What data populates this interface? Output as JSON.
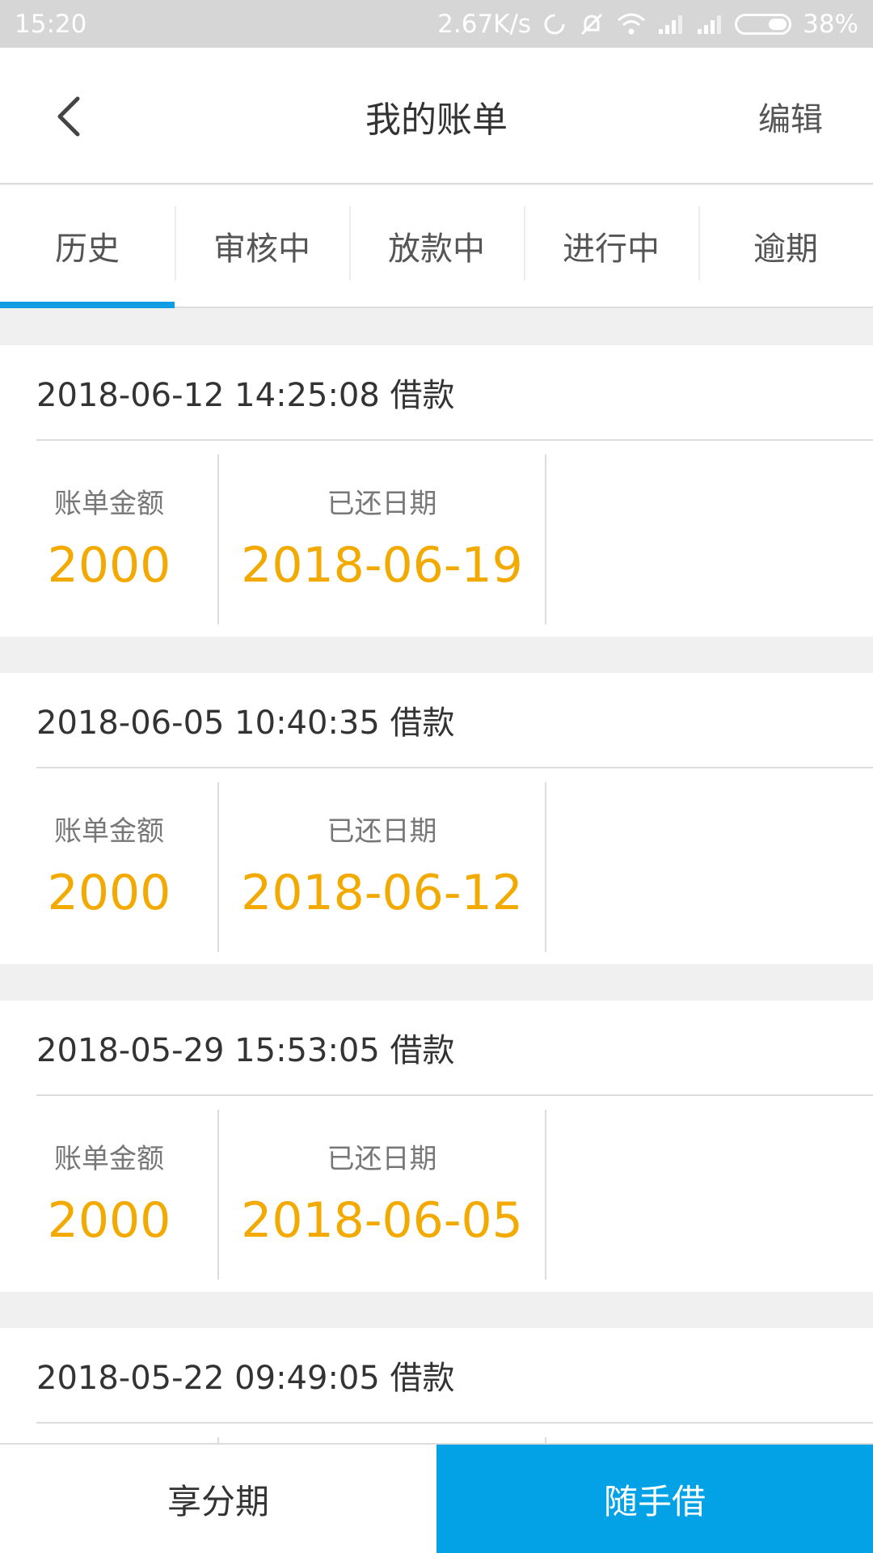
{
  "status_bar": {
    "time": "15:20",
    "speed": "2.67K/s",
    "battery_percent": "38%",
    "icons": [
      "sync-icon",
      "mute-icon",
      "wifi-icon",
      "signal-icon",
      "signal-icon",
      "battery-icon"
    ]
  },
  "header": {
    "title": "我的账单",
    "edit_label": "编辑"
  },
  "tabs": [
    {
      "label": "历史",
      "active": true
    },
    {
      "label": "审核中",
      "active": false
    },
    {
      "label": "放款中",
      "active": false
    },
    {
      "label": "进行中",
      "active": false
    },
    {
      "label": "逾期",
      "active": false
    }
  ],
  "bills": [
    {
      "datetime": "2018-06-12 14:25:08 借款",
      "amount_label": "账单金额",
      "amount": "2000",
      "date_label": "已还日期",
      "date": "2018-06-19"
    },
    {
      "datetime": "2018-06-05 10:40:35 借款",
      "amount_label": "账单金额",
      "amount": "2000",
      "date_label": "已还日期",
      "date": "2018-06-12"
    },
    {
      "datetime": "2018-05-29 15:53:05 借款",
      "amount_label": "账单金额",
      "amount": "2000",
      "date_label": "已还日期",
      "date": "2018-06-05"
    },
    {
      "datetime": "2018-05-22 09:49:05 借款",
      "amount_label": "",
      "amount": "",
      "date_label": "",
      "date": ""
    }
  ],
  "bottom_bar": {
    "left_label": "享分期",
    "right_label": "随手借"
  },
  "colors": {
    "accent_blue": "#119de3",
    "amount_orange": "#f2a900",
    "button_blue": "#03a1e6"
  }
}
